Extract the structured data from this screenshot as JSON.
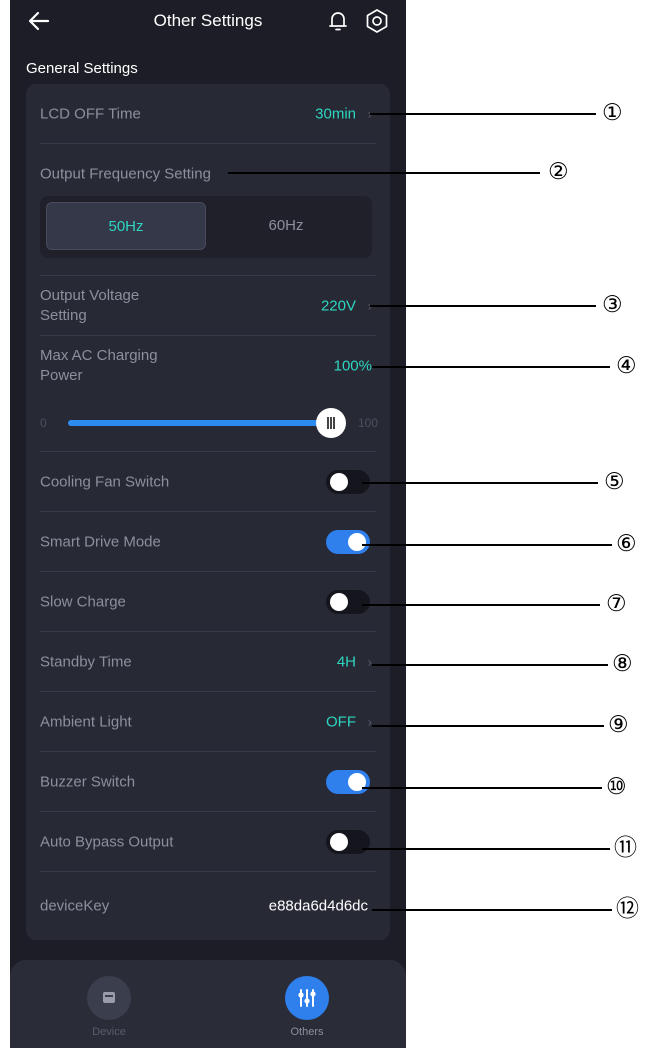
{
  "header": {
    "title": "Other Settings"
  },
  "section_title": "General Settings",
  "lcd_off": {
    "label": "LCD OFF Time",
    "value": "30min"
  },
  "output_frequency": {
    "label": "Output Frequency Setting",
    "option_a": "50Hz",
    "option_b": "60Hz",
    "selected": "50Hz"
  },
  "output_voltage": {
    "label": "Output Voltage Setting",
    "value": "220V"
  },
  "max_ac": {
    "label": "Max AC Charging Power",
    "value": "100%",
    "min": "0",
    "max": "100",
    "level": 100
  },
  "cooling_fan": {
    "label": "Cooling Fan Switch",
    "on": false
  },
  "smart_drive": {
    "label": "Smart Drive Mode",
    "on": true
  },
  "slow_charge": {
    "label": "Slow Charge",
    "on": false
  },
  "standby": {
    "label": "Standby Time",
    "value": "4H"
  },
  "ambient": {
    "label": "Ambient Light",
    "value": "OFF"
  },
  "buzzer": {
    "label": "Buzzer Switch",
    "on": true
  },
  "auto_bypass": {
    "label": "Auto Bypass Output",
    "on": false
  },
  "device_key": {
    "label": "deviceKey",
    "value": "e88da6d4d6dc"
  },
  "tabs": {
    "device": "Device",
    "others": "Others"
  },
  "callouts": [
    "①",
    "②",
    "③",
    "④",
    "⑤",
    "⑥",
    "⑦",
    "⑧",
    "⑨",
    "⑩",
    "⑪",
    "⑫"
  ],
  "colors": {
    "accent_teal": "#2ed6c0",
    "toggle_blue": "#2f80ed",
    "slider_blue": "#2d8cf0",
    "background": "#1c1d26",
    "card": "#272935"
  }
}
